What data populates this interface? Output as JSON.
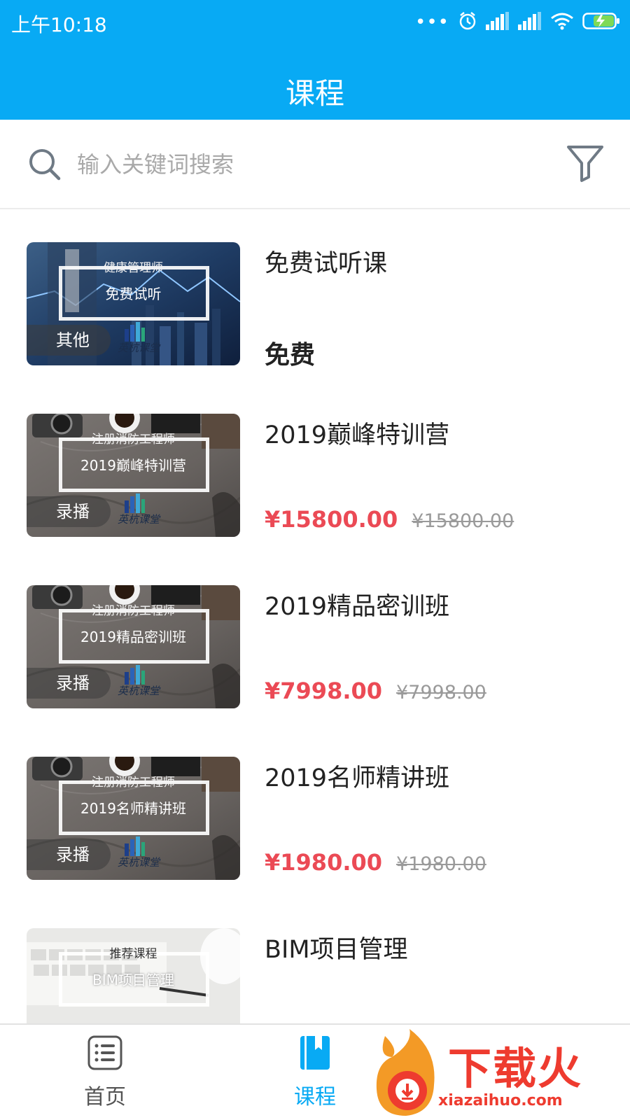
{
  "status_bar": {
    "time": "上午10:18",
    "icons": [
      "more-dots-icon",
      "alarm-icon",
      "signal-icon",
      "signal-icon",
      "wifi-icon",
      "battery-charging-icon"
    ]
  },
  "header": {
    "title": "课程"
  },
  "search": {
    "placeholder": "输入关键词搜索",
    "value": ""
  },
  "courses": [
    {
      "title": "免费试听课",
      "badge": "其他",
      "thumb_top": "健康管理师",
      "thumb_main": "免费试听",
      "thumb_logo": "英杭课堂",
      "price": "免费",
      "original_price": "",
      "free": true
    },
    {
      "title": "2019巅峰特训营",
      "badge": "录播",
      "thumb_top": "注册消防工程师",
      "thumb_main": "2019巅峰特训营",
      "thumb_logo": "英杭课堂",
      "price": "¥15800.00",
      "original_price": "¥15800.00",
      "free": false
    },
    {
      "title": "2019精品密训班",
      "badge": "录播",
      "thumb_top": "注册消防工程师",
      "thumb_main": "2019精品密训班",
      "thumb_logo": "英杭课堂",
      "price": "¥7998.00",
      "original_price": "¥7998.00",
      "free": false
    },
    {
      "title": "2019名师精讲班",
      "badge": "录播",
      "thumb_top": "注册消防工程师",
      "thumb_main": "2019名师精讲班",
      "thumb_logo": "英杭课堂",
      "price": "¥1980.00",
      "original_price": "¥1980.00",
      "free": false
    },
    {
      "title": "BIM项目管理",
      "badge": "",
      "thumb_top": "推荐课程",
      "thumb_main": "BIM项目管理",
      "thumb_logo": "",
      "price": "",
      "original_price": "",
      "free": false
    }
  ],
  "tabs": [
    {
      "label": "首页",
      "icon": "list-icon",
      "active": false
    },
    {
      "label": "课程",
      "icon": "bookmark-book-icon",
      "active": true
    }
  ],
  "watermark": {
    "text": "下载火",
    "url": "xiazaihuo.com"
  },
  "colors": {
    "primary": "#08aaf4",
    "price": "#eb4a55",
    "text": "#222222",
    "muted": "#9a9a9a"
  }
}
